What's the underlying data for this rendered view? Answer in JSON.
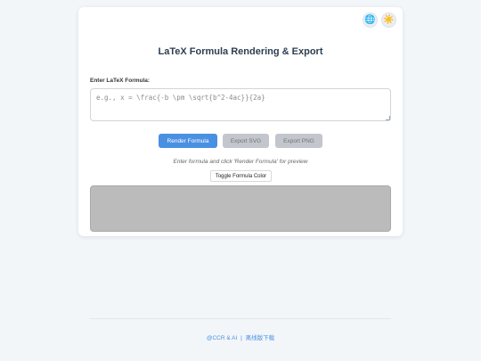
{
  "header": {
    "globe_icon": "🌐",
    "theme_icon": "☀️"
  },
  "main": {
    "title": "LaTeX Formula Rendering & Export",
    "input_label": "Enter LaTeX Formula:",
    "input_value": "",
    "input_placeholder": "e.g., x = \\frac{-b \\pm \\sqrt{b^2-4ac}}{2a}",
    "buttons": {
      "render_label": "Render Formula",
      "export_svg_label": "Export SVG",
      "export_png_label": "Export PNG"
    },
    "hint": "Enter formula and click 'Render Formula' for preview",
    "toggle_color_label": "Toggle Formula Color"
  },
  "footer": {
    "link1": "@CCR & AI",
    "separator": "|",
    "link2": "离线版下载"
  },
  "colors": {
    "accent": "#4a90e2",
    "disabled": "#c3c6cc",
    "preview_bg": "#bbbbbb",
    "title": "#2c3e50"
  }
}
